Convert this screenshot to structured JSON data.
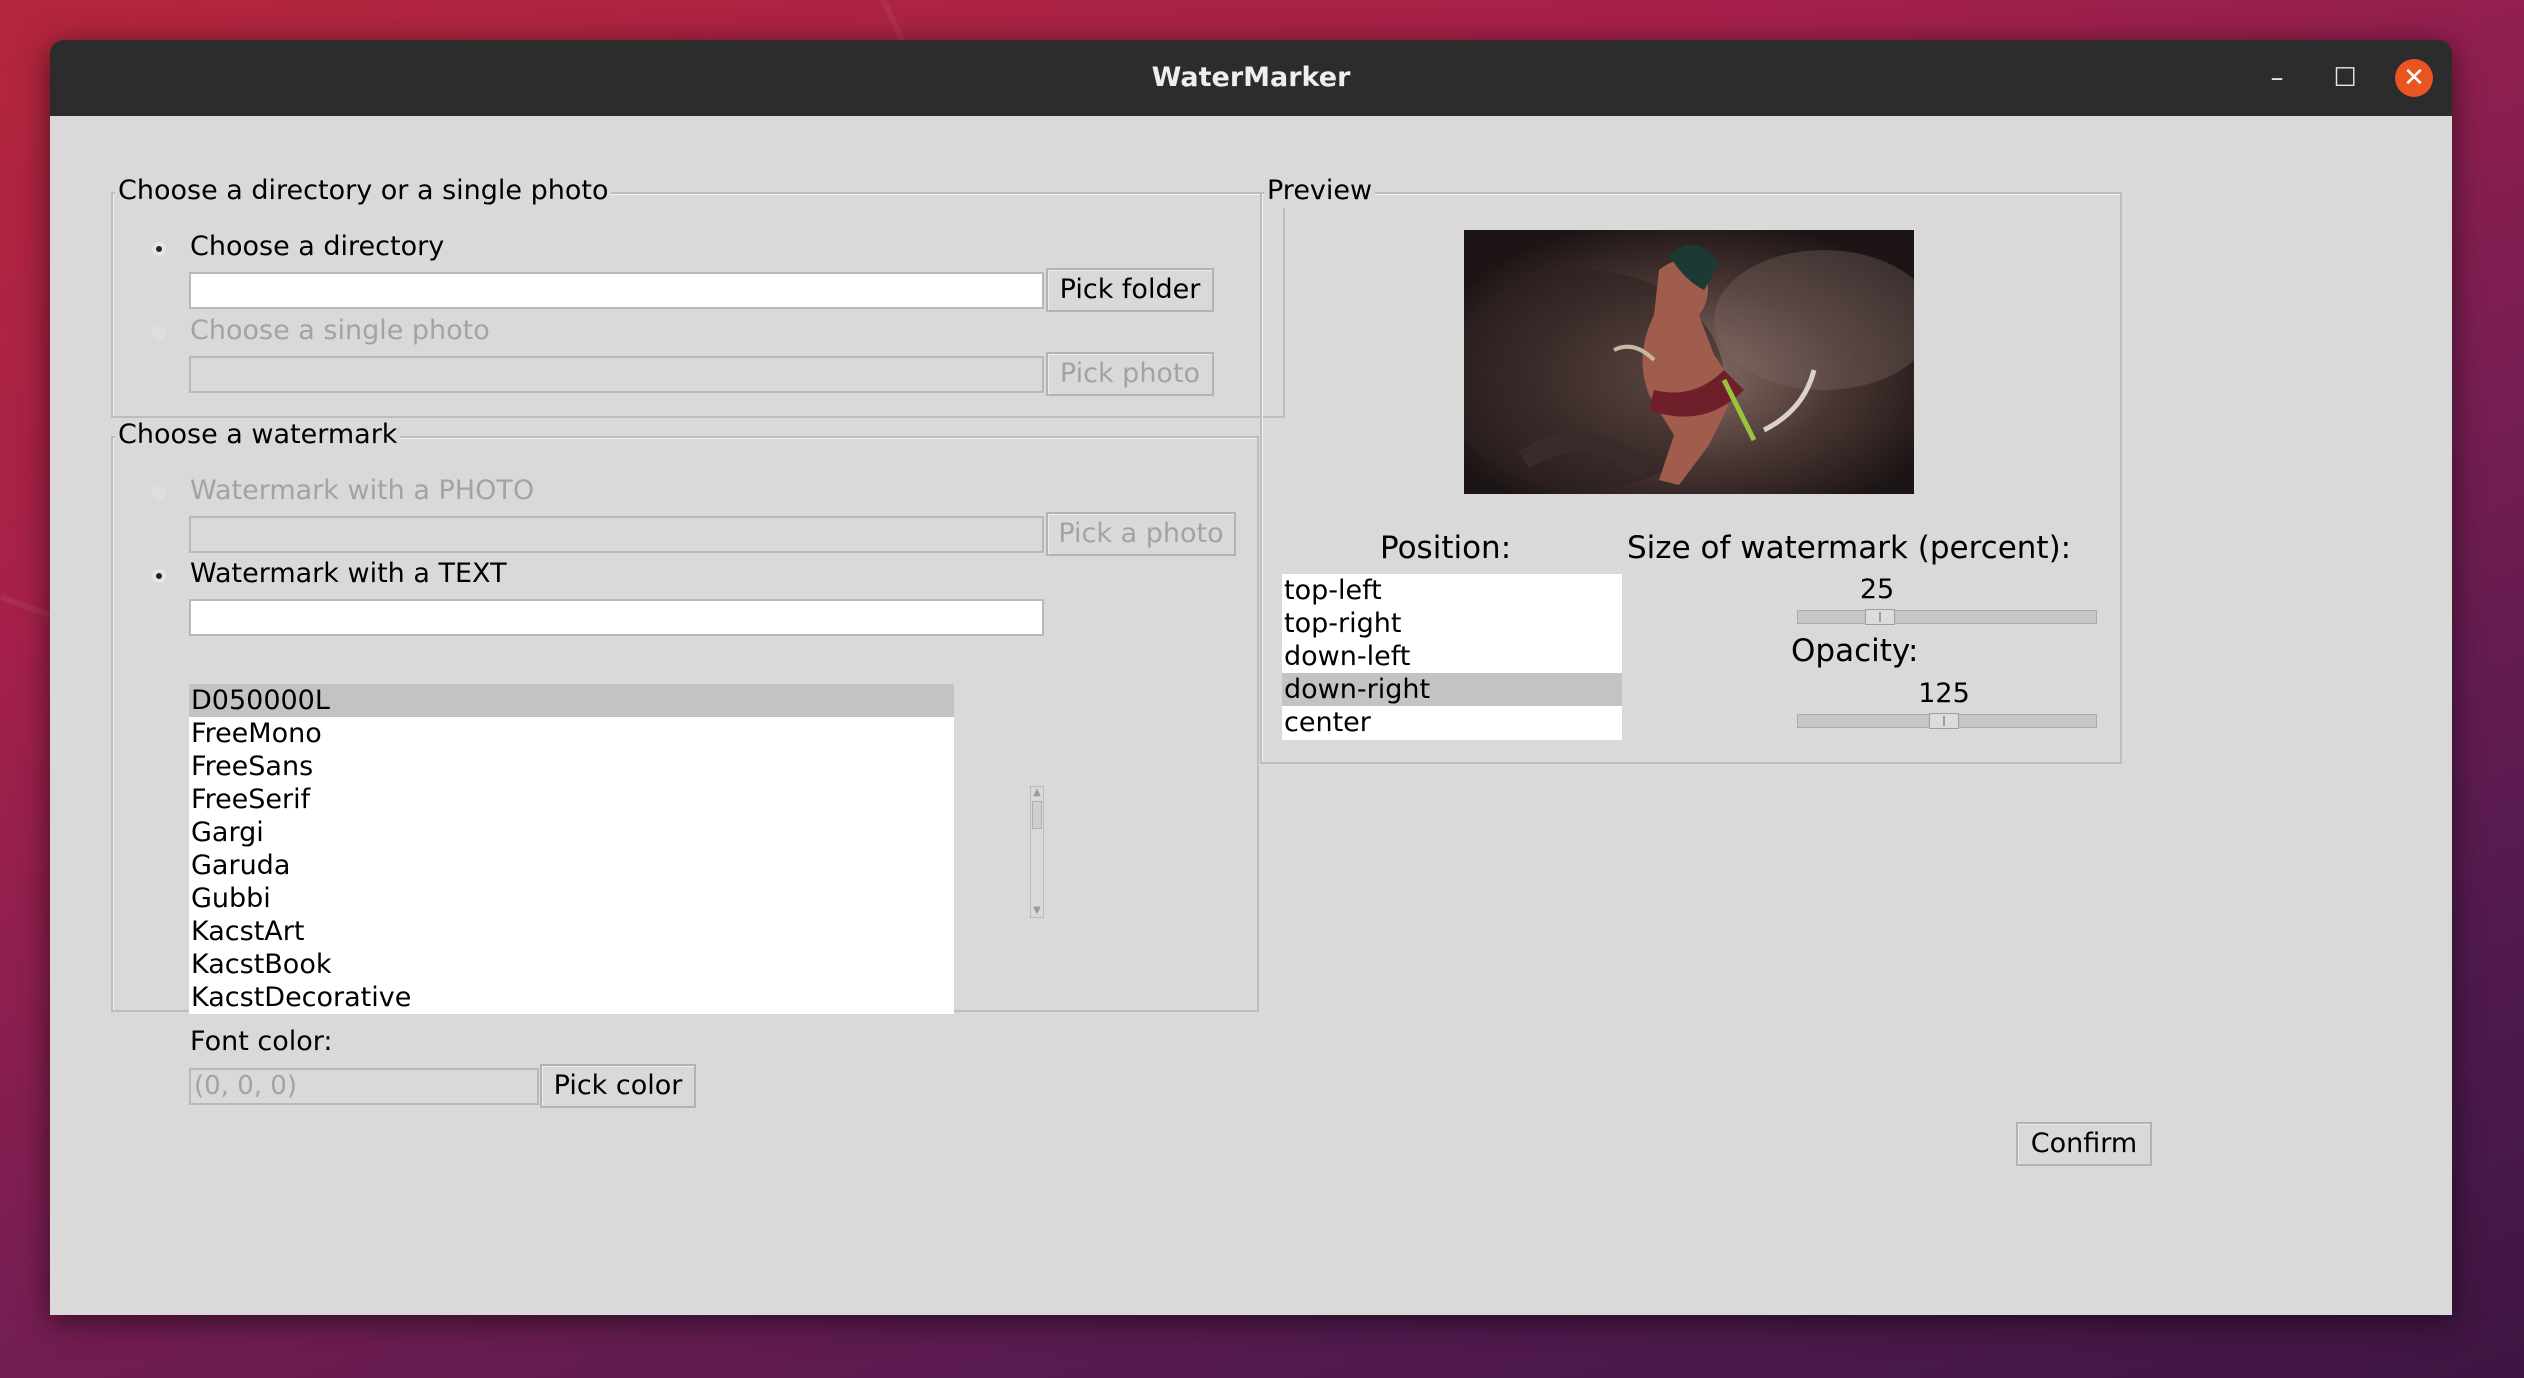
{
  "window": {
    "title": "WaterMarker",
    "minimize_glyph": "–",
    "maximize_glyph": "☐",
    "close_glyph": "✕"
  },
  "source": {
    "legend": "Choose a directory or a single photo",
    "directory_radio_label": "Choose a directory",
    "directory_path": "",
    "pick_folder_label": "Pick folder",
    "photo_radio_label": "Choose a single photo",
    "photo_path": "",
    "pick_photo_label": "Pick photo"
  },
  "watermark": {
    "legend": "Choose a watermark",
    "photo_radio_label": "Watermark with a PHOTO",
    "photo_path": "",
    "pick_a_photo_label": "Pick a photo",
    "text_radio_label": "Watermark with a TEXT",
    "text_value": "",
    "fonts": [
      "D050000L",
      "FreeMono",
      "FreeSans",
      "FreeSerif",
      "Gargi",
      "Garuda",
      "Gubbi",
      "KacstArt",
      "KacstBook",
      "KacstDecorative"
    ],
    "selected_font": "D050000L",
    "font_color_label": "Font color:",
    "font_color_value": "(0, 0, 0)",
    "pick_color_label": "Pick color"
  },
  "preview": {
    "legend": "Preview",
    "position_label": "Position:",
    "positions": [
      "top-left",
      "top-right",
      "down-left",
      "down-right",
      "center"
    ],
    "selected_position": "down-right",
    "size_label": "Size of watermark (percent):",
    "size_value": "25",
    "size_fraction": 0.25,
    "opacity_label": "Opacity:",
    "opacity_value": "125",
    "opacity_fraction": 0.49
  },
  "confirm_label": "Confirm",
  "colors": {
    "window_bg": "#d9d9d9",
    "titlebar_bg": "#2c2c2c",
    "close_button": "#e95420",
    "selected_item": "#c3c3c3"
  }
}
